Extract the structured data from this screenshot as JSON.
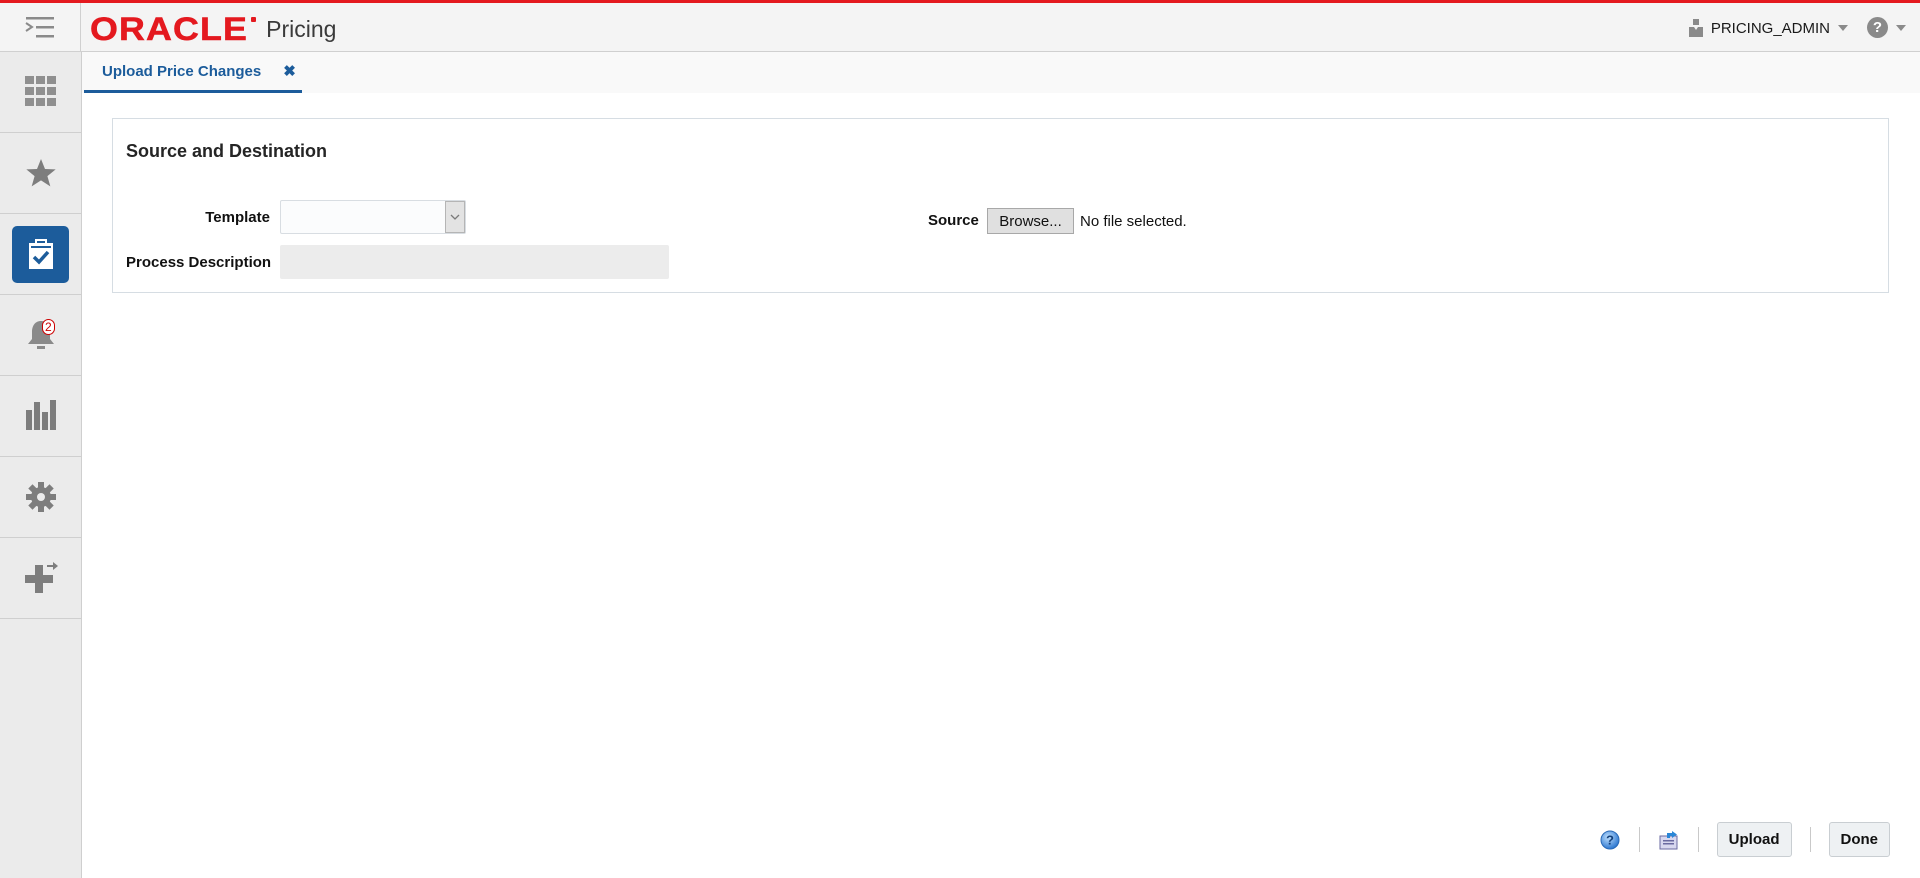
{
  "header": {
    "brand": "ORACLE",
    "app_name": "Pricing",
    "user_name": "PRICING_ADMIN",
    "menu_icon": "hamburger-menu-icon",
    "user_icon": "user-icon",
    "help_icon": "help-icon",
    "help_glyph": "?",
    "accent_color": "#e4191f"
  },
  "sidebar": {
    "items": [
      {
        "icon": "apps-grid-icon",
        "active": false
      },
      {
        "icon": "star-icon",
        "active": false
      },
      {
        "icon": "task-clipboard-icon",
        "active": true
      },
      {
        "icon": "bell-icon",
        "active": false,
        "badge": "2"
      },
      {
        "icon": "reports-bar-chart-icon",
        "active": false
      },
      {
        "icon": "gear-icon",
        "active": false
      },
      {
        "icon": "add-plus-icon",
        "active": false
      }
    ],
    "active_color": "#1c5c9b"
  },
  "tabs": [
    {
      "label": "Upload Price Changes",
      "close_glyph": "✖",
      "active": true
    }
  ],
  "section": {
    "title": "Source and Destination",
    "template_label": "Template",
    "template_value": "",
    "process_description_label": "Process Description",
    "process_description_value": "",
    "source_label": "Source",
    "browse_label": "Browse...",
    "file_status": "No file selected."
  },
  "footer": {
    "help_glyph": "?",
    "upload_label": "Upload",
    "done_label": "Done"
  }
}
